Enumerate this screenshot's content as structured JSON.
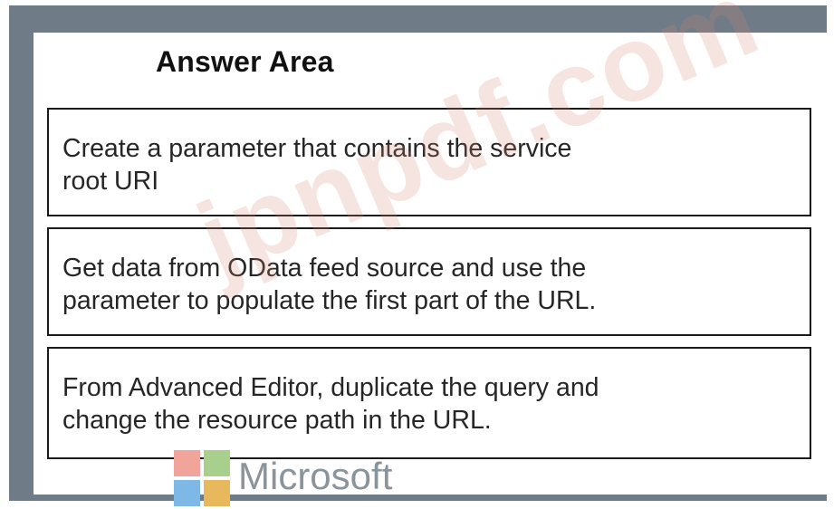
{
  "answer_area": {
    "title": "Answer Area",
    "items": [
      {
        "text": "Create a parameter that contains the service\nroot URI"
      },
      {
        "text": "Get data from OData feed source and use the\nparameter to populate the first part of the URL."
      },
      {
        "text": "From Advanced Editor, duplicate the query and\nchange the resource path in the URL."
      }
    ]
  },
  "watermark": {
    "text": "jpnpdf.com"
  },
  "branding": {
    "name": "Microsoft",
    "colors": {
      "red": "#f0a49a",
      "green": "#a8d08d",
      "blue": "#7eb8e6",
      "yellow": "#e7b85c"
    }
  }
}
